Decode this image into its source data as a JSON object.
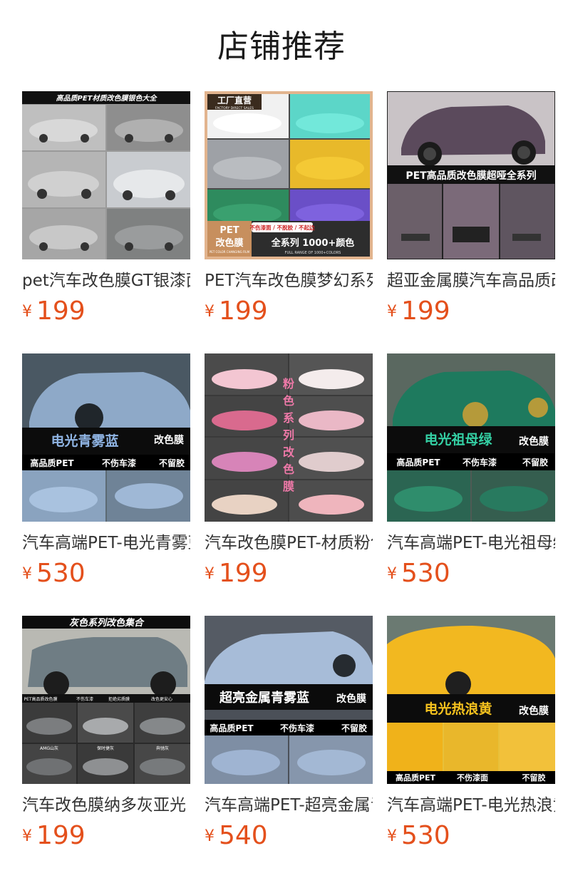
{
  "page_title": "店铺推荐",
  "currency_symbol": "¥",
  "products": [
    {
      "title": "pet汽车改色膜GT银漆面",
      "price": "199",
      "image_texts": [
        "高品质PET材质改色膜银色大全"
      ]
    },
    {
      "title": "PET汽车改色膜梦幻系列",
      "price": "199",
      "image_texts": [
        "工厂直营",
        "FACTORY DIRECT SALES",
        "PET",
        "改色膜",
        "PET COLOR CHANGING FILM",
        "不伤漆面 / 不脱胶 / 不起边",
        "全系列 1000+颜色",
        "FULL RANGE OF 1000+COLORS"
      ]
    },
    {
      "title": "超亚金属膜汽车高品质改色膜",
      "price": "199",
      "image_texts": [
        "PET高品质改色膜超哑全系列"
      ]
    },
    {
      "title": "汽车高端PET-电光青雾蓝",
      "price": "530",
      "image_texts": [
        "电光青雾蓝",
        "改色膜",
        "高品质PET",
        "不伤车漆",
        "不留胶"
      ]
    },
    {
      "title": "汽车改色膜PET-材质粉色系列",
      "price": "199",
      "image_texts": [
        "粉色系列改色膜"
      ]
    },
    {
      "title": "汽车高端PET-电光祖母绿",
      "price": "530",
      "image_texts": [
        "电光祖母绿",
        "改色膜",
        "高品质PET",
        "不伤车漆",
        "不留胶"
      ]
    },
    {
      "title": "汽车改色膜纳多灰亚光",
      "price": "199",
      "image_texts": [
        "灰色系列改色集合",
        "PET高品质改色膜",
        "不伤车漆",
        "拒绝劣质膜",
        "改色更安心",
        "AMG山灰",
        "保时捷灰",
        "奔驰灰"
      ]
    },
    {
      "title": "汽车高端PET-超亮金属青雾蓝",
      "price": "540",
      "image_texts": [
        "超亮金属青雾蓝",
        "改色膜",
        "高品质PET",
        "不伤车漆",
        "不留胶"
      ]
    },
    {
      "title": "汽车高端PET-电光热浪黄",
      "price": "530",
      "image_texts": [
        "电光热浪黄",
        "改色膜",
        "高品质PET",
        "不伤漆面",
        "不留胶"
      ]
    }
  ],
  "colors": {
    "price": "#e4501c",
    "title": "#333333",
    "heading": "#1a1a1a"
  }
}
